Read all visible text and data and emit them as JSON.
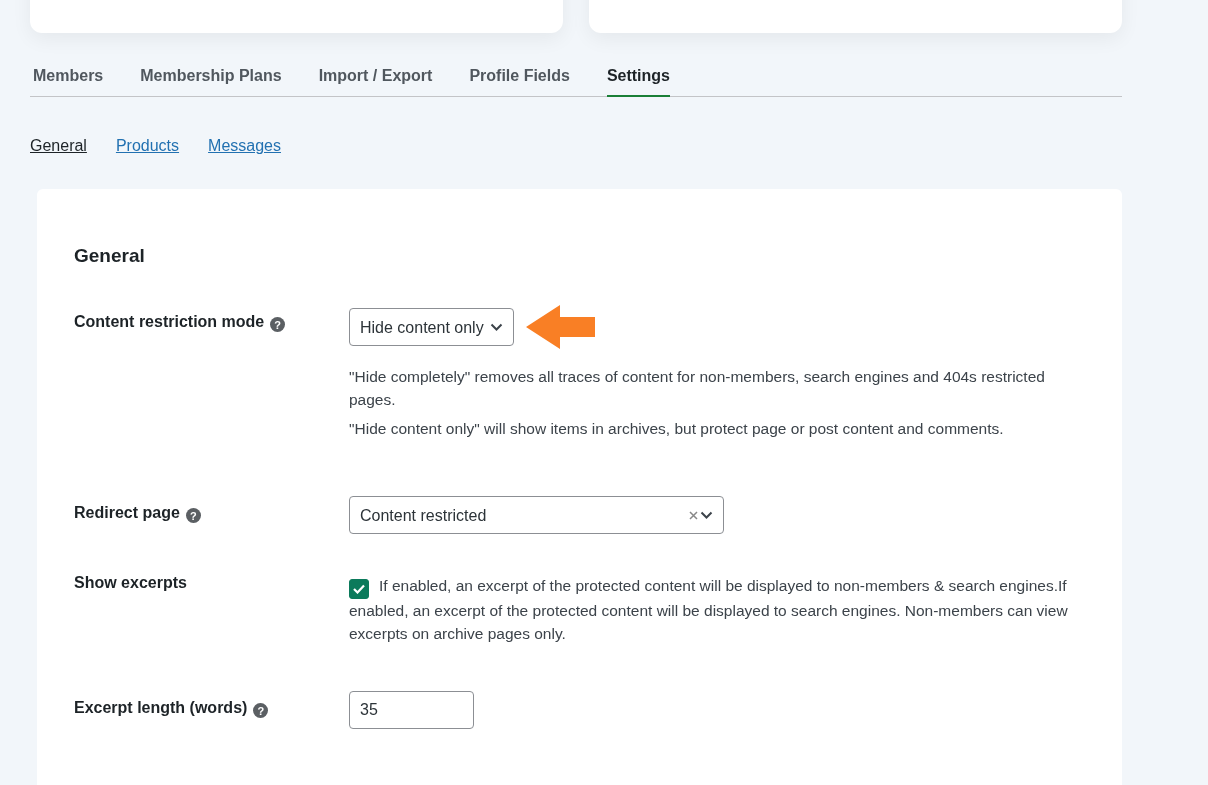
{
  "summary_cards": [
    {
      "kind": "card"
    },
    {
      "kind": "card"
    }
  ],
  "tabs": [
    {
      "label": "Members",
      "selected": false
    },
    {
      "label": "Membership Plans",
      "selected": false
    },
    {
      "label": "Import / Export",
      "selected": false
    },
    {
      "label": "Profile Fields",
      "selected": false
    },
    {
      "label": "Settings",
      "selected": true
    }
  ],
  "subnav": [
    {
      "label": "General",
      "selected": true
    },
    {
      "label": "Products",
      "selected": false
    },
    {
      "label": "Messages",
      "selected": false
    }
  ],
  "section_title": "General",
  "settings": [
    {
      "kind": "select",
      "label": "Content restriction mode",
      "help": "?",
      "value": "Hide content only",
      "pointer_arrow": true,
      "descriptions": [
        "\"Hide completely\" removes all traces of content for non-members, search engines and 404s restricted pages.",
        "\"Hide content only\" will show items in archives, but protect page or post content and comments."
      ]
    },
    {
      "kind": "clearable_select",
      "label": "Redirect page",
      "help": "?",
      "value": "Content restricted"
    },
    {
      "kind": "checkbox",
      "label": "Show excerpts",
      "checked": true,
      "description": "If enabled, an excerpt of the protected content will be displayed to non-members & search engines.If enabled, an excerpt of the protected content will be displayed to search engines. Non-members can view excerpts on archive pages only."
    },
    {
      "kind": "number",
      "label": "Excerpt length (words)",
      "help": "?",
      "value": "35"
    }
  ]
}
